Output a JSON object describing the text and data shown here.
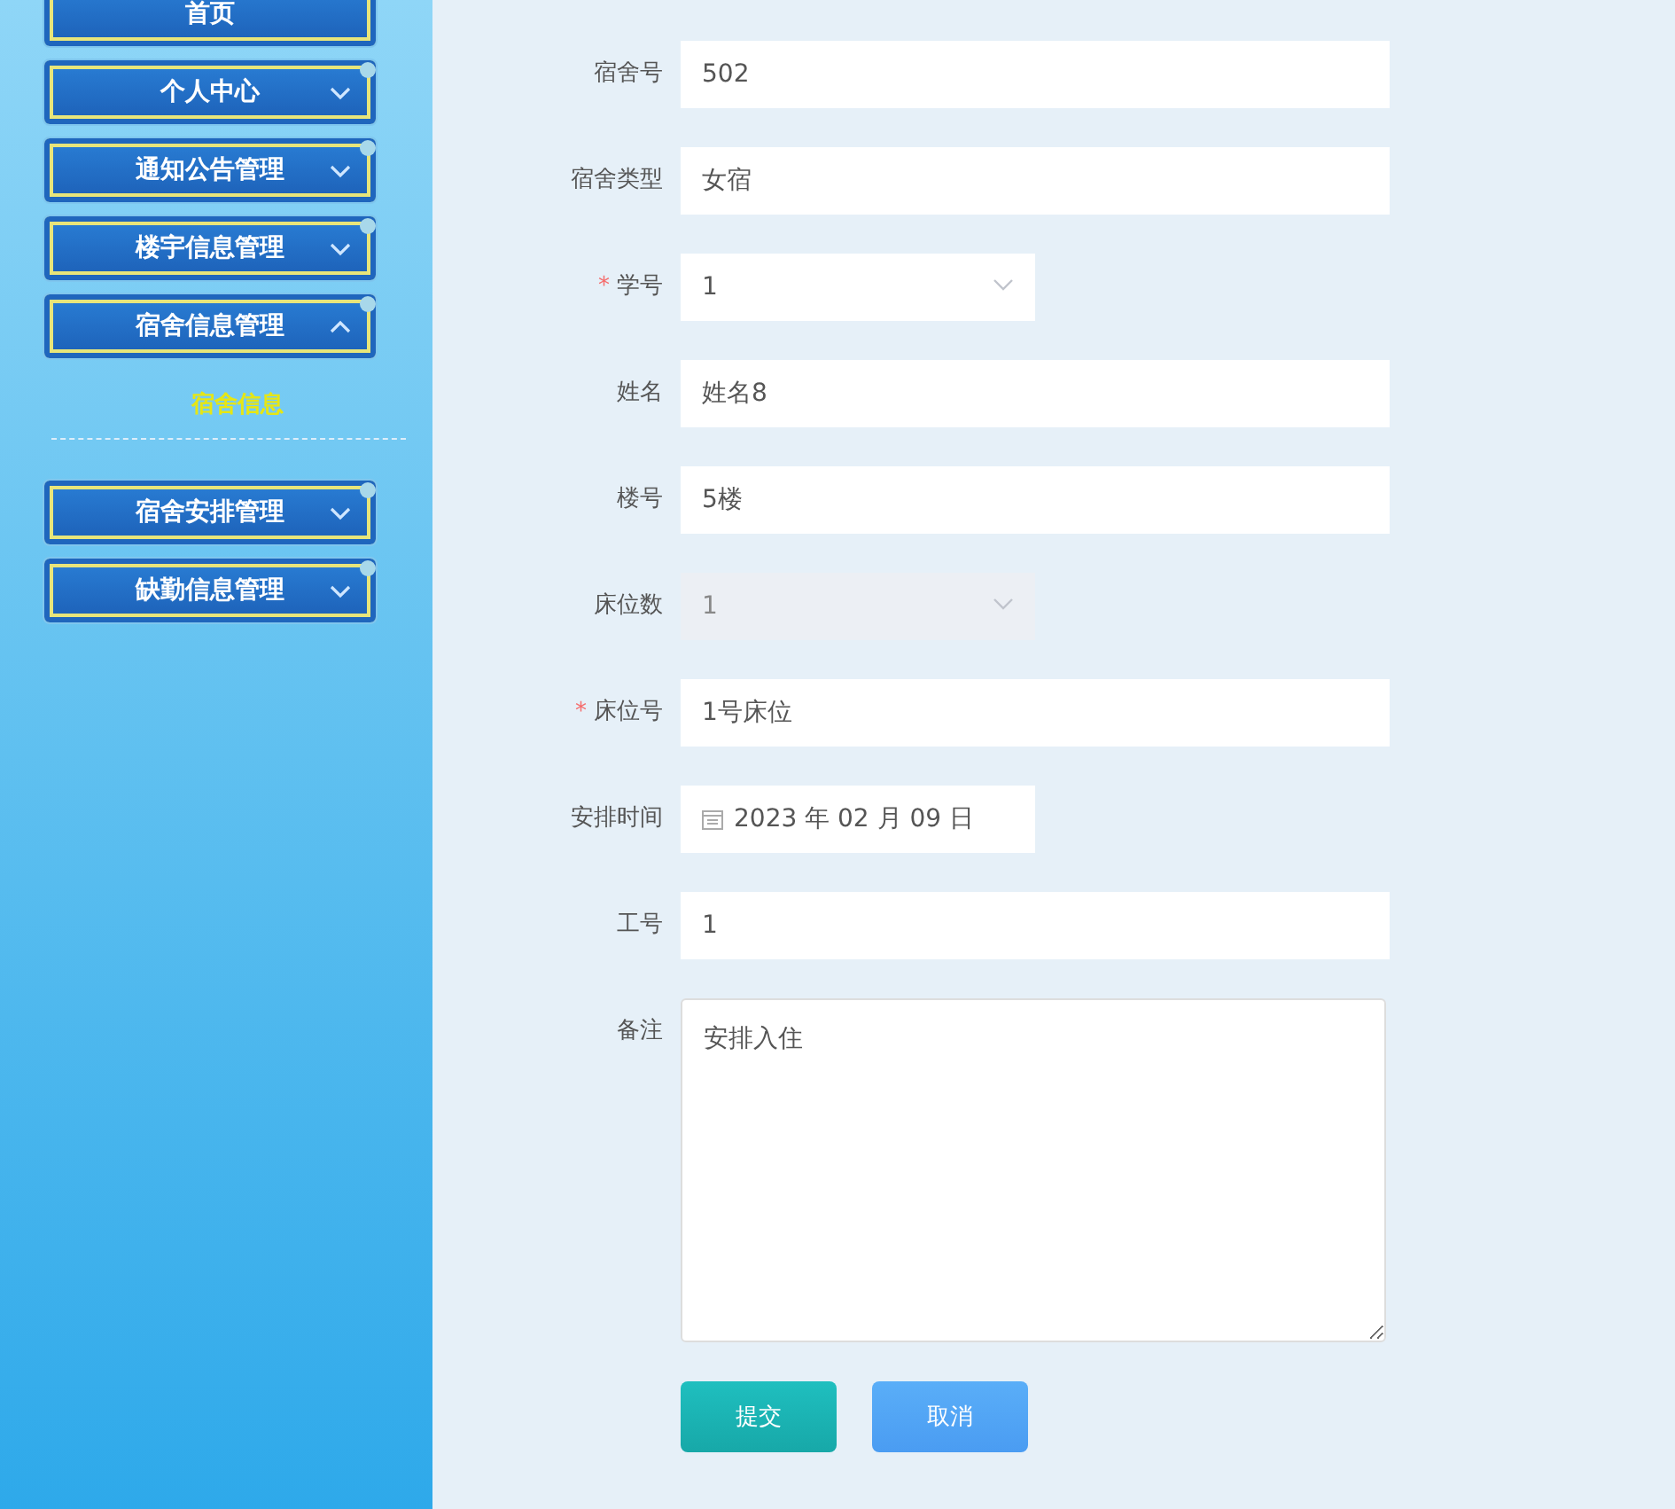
{
  "sidebar": {
    "items": [
      {
        "label": "首页"
      },
      {
        "label": "个人中心",
        "expanded": false
      },
      {
        "label": "通知公告管理",
        "expanded": false
      },
      {
        "label": "楼宇信息管理",
        "expanded": false
      },
      {
        "label": "宿舍信息管理",
        "expanded": true,
        "children": [
          {
            "label": "宿舍信息"
          }
        ]
      },
      {
        "label": "宿舍安排管理",
        "expanded": false
      },
      {
        "label": "缺勤信息管理",
        "expanded": false
      }
    ]
  },
  "form": {
    "required_mark": "*",
    "fields": [
      {
        "label": "宿舍号",
        "kind": "text",
        "value": "502",
        "required": false,
        "disabled": false
      },
      {
        "label": "宿舍类型",
        "kind": "text",
        "value": "女宿",
        "required": false,
        "disabled": false
      },
      {
        "label": "学号",
        "kind": "select",
        "value": "1",
        "required": true,
        "disabled": false
      },
      {
        "label": "姓名",
        "kind": "text",
        "value": "姓名8",
        "required": false,
        "disabled": false
      },
      {
        "label": "楼号",
        "kind": "text",
        "value": "5楼",
        "required": false,
        "disabled": false
      },
      {
        "label": "床位数",
        "kind": "select",
        "value": "1",
        "required": false,
        "disabled": true
      },
      {
        "label": "床位号",
        "kind": "text",
        "value": "1号床位",
        "required": true,
        "disabled": false
      },
      {
        "label": "安排时间",
        "kind": "date",
        "value": "2023 年 02 月 09 日",
        "required": false,
        "disabled": false
      },
      {
        "label": "工号",
        "kind": "text",
        "value": "1",
        "required": false,
        "disabled": false
      },
      {
        "label": "备注",
        "kind": "textarea",
        "value": "安排入住",
        "required": false,
        "disabled": false
      }
    ],
    "buttons": [
      {
        "label": "提交",
        "kind": "primary"
      },
      {
        "label": "取消",
        "kind": "secondary"
      }
    ]
  }
}
